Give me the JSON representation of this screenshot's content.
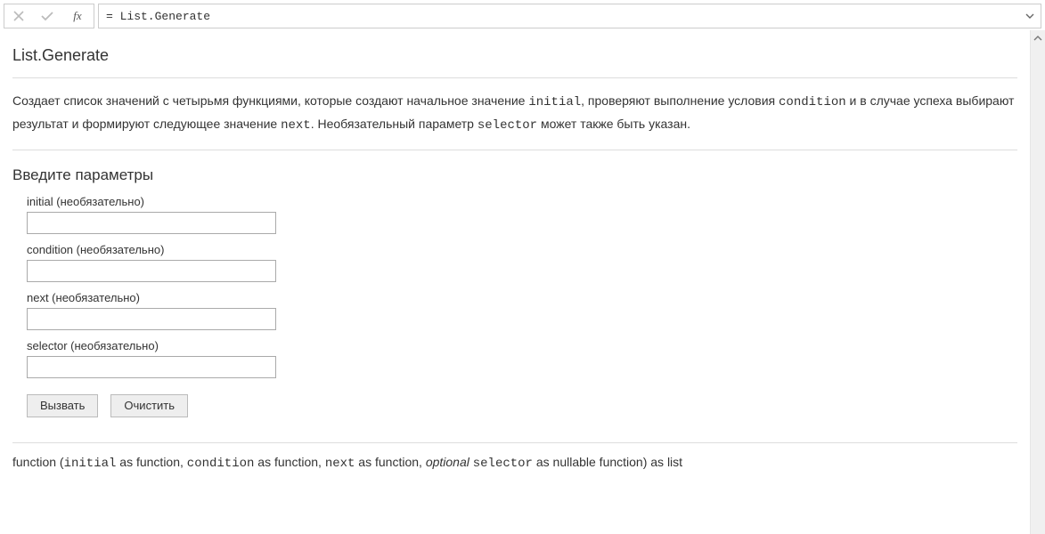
{
  "formula": {
    "fx_label": "fx",
    "text": "= List.Generate"
  },
  "doc": {
    "title": "List.Generate",
    "desc_part1": "Создает список значений с четырьмя функциями, которые создают начальное значение ",
    "desc_code1": "initial",
    "desc_part2": ", проверяют выполнение условия ",
    "desc_code2": "condition",
    "desc_part3": " и в случае успеха выбирают результат и формируют следующее значение ",
    "desc_code3": "next",
    "desc_part4": ". Необязательный параметр ",
    "desc_code4": "selector",
    "desc_part5": " может также быть указан."
  },
  "params": {
    "heading": "Введите параметры",
    "items": [
      {
        "label": "initial (необязательно)",
        "value": ""
      },
      {
        "label": "condition (необязательно)",
        "value": ""
      },
      {
        "label": "next (необязательно)",
        "value": ""
      },
      {
        "label": "selector (необязательно)",
        "value": ""
      }
    ]
  },
  "buttons": {
    "invoke": "Вызвать",
    "clear": "Очистить"
  },
  "signature": {
    "t0": "function (",
    "p1": "initial",
    "t1": " as function, ",
    "p2": "condition",
    "t2": " as function, ",
    "p3": "next",
    "t3": " as function, ",
    "opt": "optional ",
    "p4": "selector",
    "t4": " as nullable function) as list"
  }
}
